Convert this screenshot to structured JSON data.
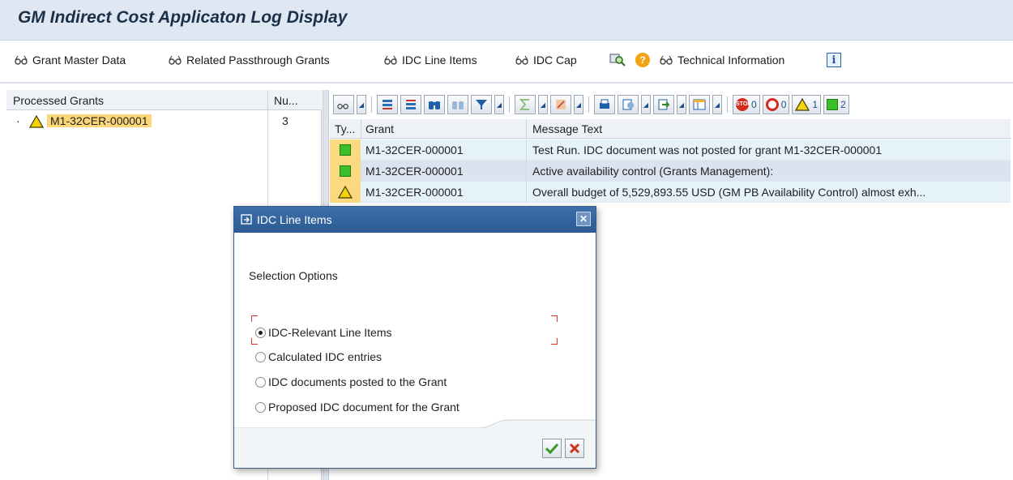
{
  "window": {
    "title": "GM Indirect Cost  Applicaton Log Display"
  },
  "toolbar": {
    "grant_master_data": "Grant Master Data",
    "related_passthrough": "Related Passthrough Grants",
    "idc_line_items": "IDC Line Items",
    "idc_cap": "IDC Cap",
    "technical_information": "Technical Information"
  },
  "left_panel": {
    "header_col1": "Processed Grants",
    "header_col2": "Nu...",
    "tree": [
      {
        "label": "M1-32CER-000001",
        "count": "3",
        "status": "warning"
      }
    ]
  },
  "alv_toolbar": {
    "count_stop": "0",
    "count_error": "0",
    "count_warning": "1",
    "count_success": "2"
  },
  "log_grid": {
    "columns": [
      "Ty...",
      "Grant",
      "Message Text"
    ],
    "rows": [
      {
        "type": "success",
        "grant": "M1-32CER-000001",
        "message": "Test Run. IDC document was not posted for grant M1-32CER-000001"
      },
      {
        "type": "success",
        "grant": "M1-32CER-000001",
        "message": "Active availability control (Grants Management):"
      },
      {
        "type": "warning",
        "grant": "M1-32CER-000001",
        "message": "Overall budget of 5,529,893.55 USD (GM PB Availability Control) almost exh..."
      }
    ]
  },
  "dialog": {
    "title": "IDC Line Items",
    "section_label": "Selection Options",
    "options": [
      {
        "label": "IDC-Relevant Line Items",
        "selected": true
      },
      {
        "label": "Calculated IDC entries",
        "selected": false
      },
      {
        "label": "IDC documents posted to the Grant",
        "selected": false
      },
      {
        "label": "Proposed IDC document for the Grant",
        "selected": false
      }
    ]
  },
  "colors": {
    "title_bg": "#dfe8f2",
    "dialog_title_bg": "#2b5a92",
    "row_highlight": "#fcd77a",
    "success_green": "#3bbf2a",
    "error_red": "#d42b1e",
    "warning_yellow": "#f5d20a"
  }
}
